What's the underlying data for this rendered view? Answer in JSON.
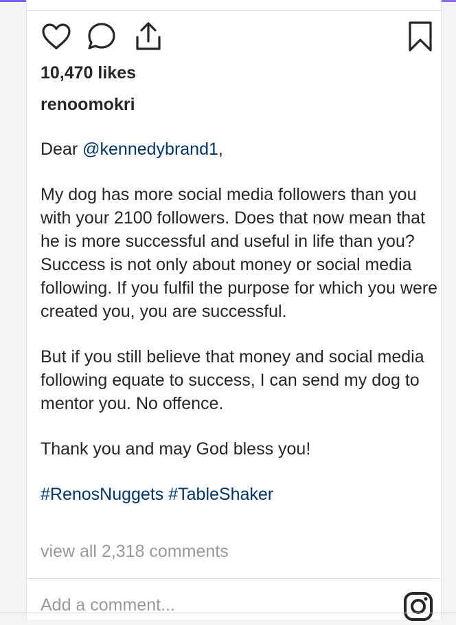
{
  "post": {
    "likes": "10,470 likes",
    "username": "renoomokri",
    "caption": {
      "greeting_prefix": "Dear ",
      "mention": "@kennedybrand1",
      "greeting_suffix": ",",
      "paragraph_1": "My dog has more social media followers than you with your 2100 followers. Does that now mean that he is more successful and useful in life than you? Success is not only about money or social media following. If you fulfil the purpose for which you were created you, you are successful.",
      "paragraph_2": "But if you still believe that money and social media following equate to success, I can send my dog to mentor you. No offence.",
      "paragraph_3": "Thank you and may God bless you!",
      "hashtags": "#RenosNuggets #TableShaker"
    },
    "view_comments": "view all 2,318 comments",
    "comment_placeholder": "Add a comment..."
  },
  "icons": {
    "like": "heart-icon",
    "comment": "comment-bubble-icon",
    "share": "share-upload-icon",
    "save": "bookmark-icon",
    "brand": "instagram-icon"
  }
}
